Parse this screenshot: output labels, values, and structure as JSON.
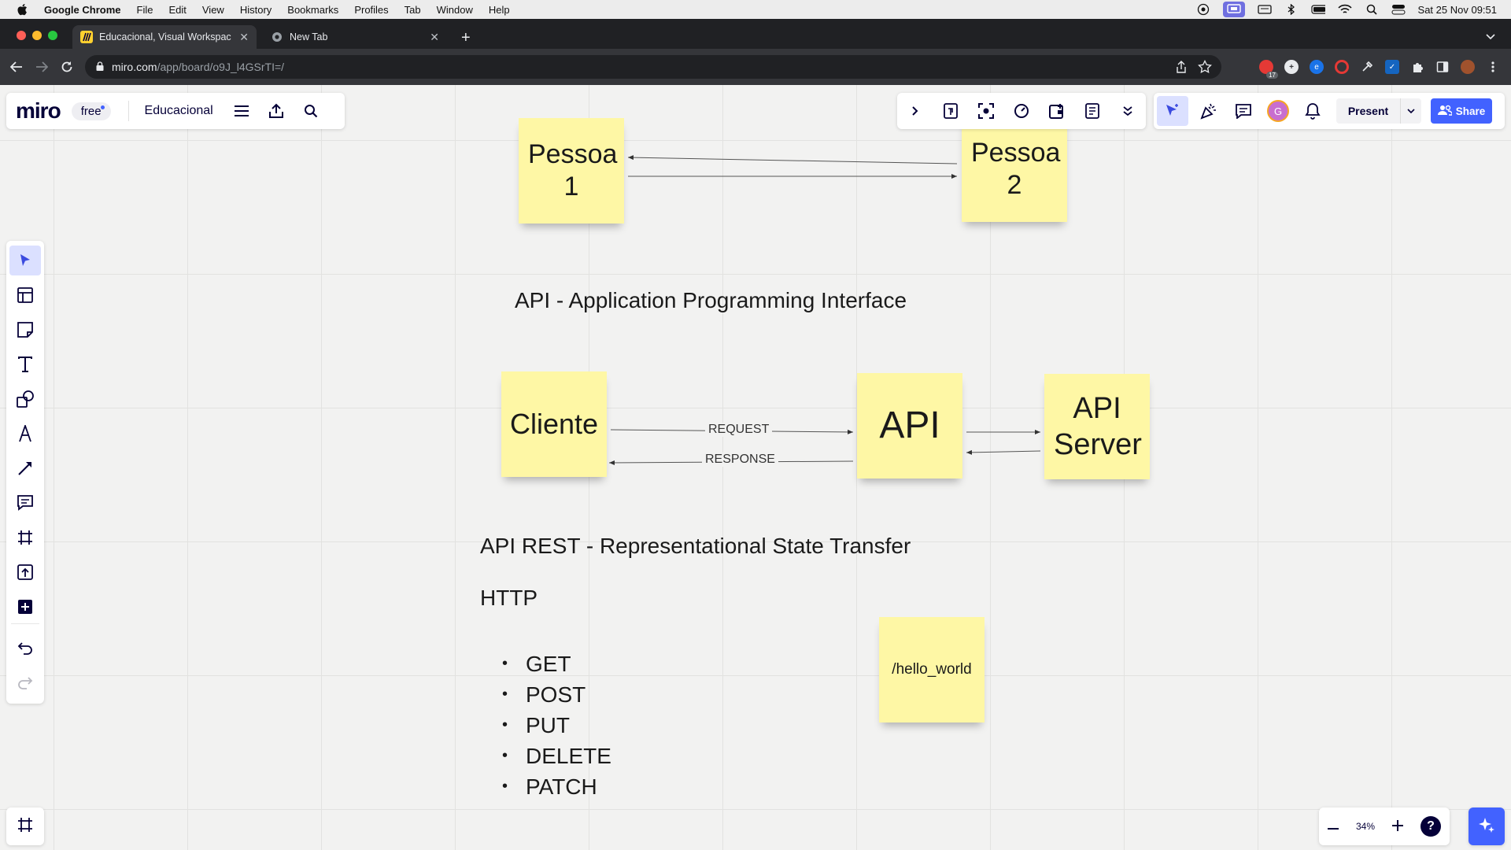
{
  "menubar": {
    "app_name": "Google Chrome",
    "items": [
      "File",
      "Edit",
      "View",
      "History",
      "Bookmarks",
      "Profiles",
      "Tab",
      "Window",
      "Help"
    ],
    "clock": "Sat 25 Nov  09:51"
  },
  "tabs": [
    {
      "title": "Educacional, Visual Workspac",
      "active": true
    },
    {
      "title": "New Tab",
      "active": false
    }
  ],
  "address_bar": {
    "host": "miro.com",
    "path": "/app/board/o9J_l4GSrTI=/"
  },
  "extensions": {
    "badge_count": "17"
  },
  "miro": {
    "logo": "miro",
    "plan": "free",
    "board_name": "Educacional",
    "avatar_letter": "G",
    "present_label": "Present",
    "share_label": "Share",
    "zoom_level": "34%",
    "help_label": "?"
  },
  "board": {
    "sticky_pessoa1": "Pessoa 1",
    "sticky_pessoa2": "Pessoa 2",
    "api_title": "API - Application Programming Interface",
    "sticky_cliente": "Cliente",
    "sticky_api": "API",
    "sticky_api_server": "API Server",
    "request_label": "REQUEST",
    "response_label": "RESPONSE",
    "rest_title": "API REST - Representational State Transfer",
    "http_title": "HTTP",
    "http_methods": [
      "GET",
      "POST",
      "PUT",
      "DELETE",
      "PATCH"
    ],
    "sticky_hello": "/hello_world"
  },
  "colors": {
    "sticky": "#fef7a5",
    "accent": "#4262ff",
    "board_bg": "#f2f2f1"
  }
}
